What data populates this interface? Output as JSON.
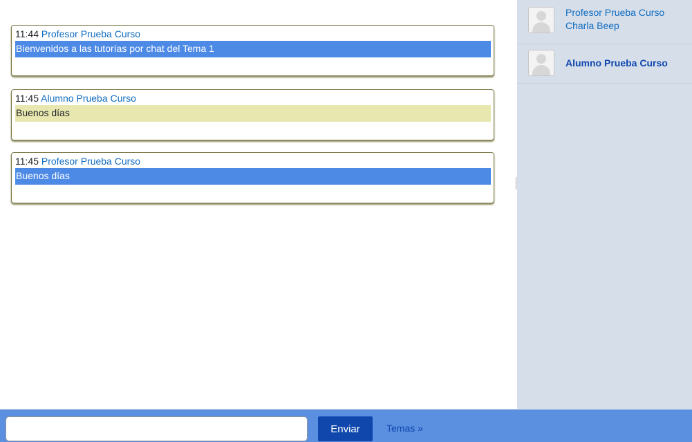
{
  "messages": [
    {
      "time": "11:44",
      "user": "Profesor Prueba Curso",
      "text": "Bienvenidos a las tutorías por chat del Tema 1",
      "role": "teacher",
      "bg": "#4d8ae6"
    },
    {
      "time": "11:45",
      "user": "Alumno Prueba Curso",
      "text": "Buenos días",
      "role": "student",
      "bg": "#e8e7b0"
    },
    {
      "time": "11:45",
      "user": "Profesor Prueba Curso",
      "text": "Buenos días",
      "role": "teacher",
      "bg": "#4d8ae6"
    }
  ],
  "users": [
    {
      "name": "Profesor Prueba Curso",
      "action": "Charla Beep"
    },
    {
      "name": "Alumno Prueba Curso"
    }
  ],
  "composer": {
    "input_value": "",
    "send_label": "Enviar",
    "themes_label": "Temas »"
  },
  "colors": {
    "accent": "#0f47ad",
    "bottom_bar": "#5b8fe0",
    "sidebar": "#d6deea",
    "link": "#0f6cbf"
  }
}
